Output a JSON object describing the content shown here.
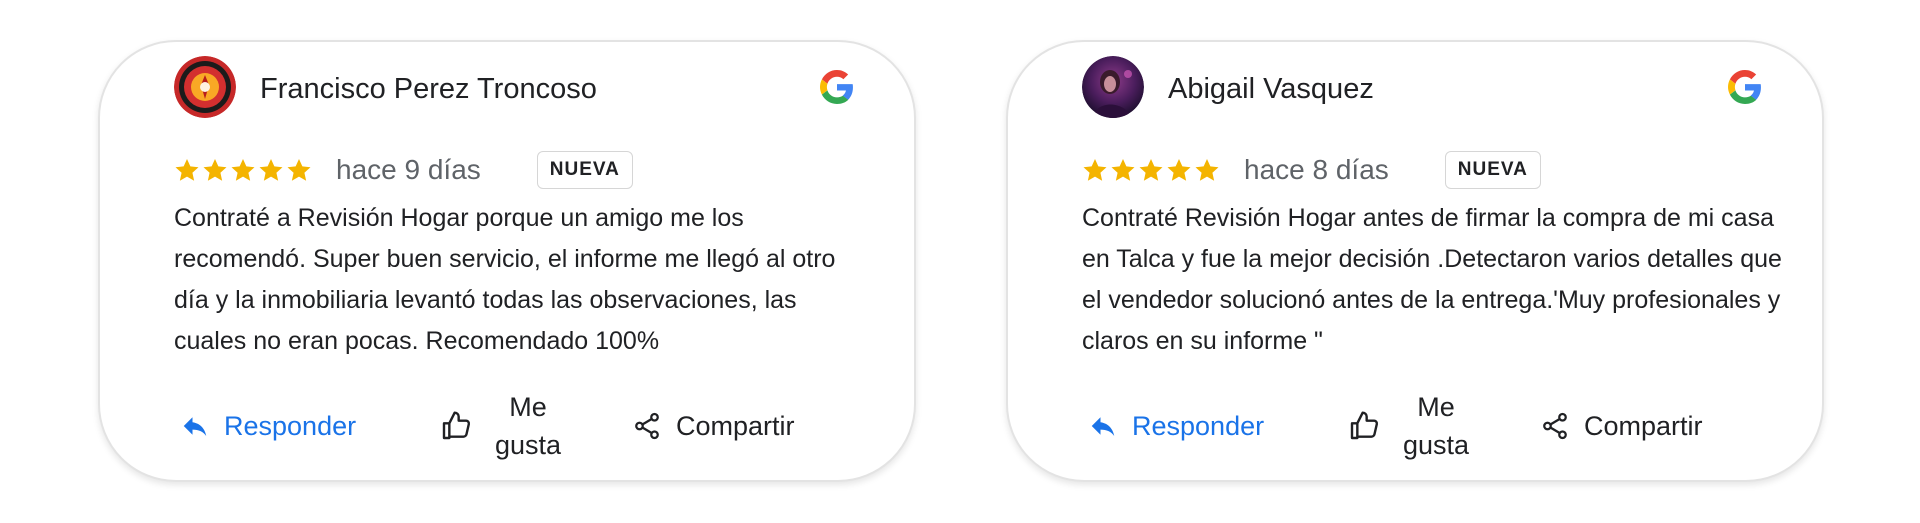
{
  "reviews": [
    {
      "author": "Francisco Perez Troncoso",
      "date": "hace 9 días",
      "badge": "NUEVA",
      "rating": 5,
      "text": "Contraté a Revisión Hogar porque un amigo me los recomendó. Super buen servicio, el informe me llegó al otro día y la inmobiliaria levantó todas las observaciones, las cuales no eran pocas. Recomendado 100%",
      "avatar_icon": "fire-department-logo-icon",
      "actions": {
        "reply": "Responder",
        "like_line1": "Me",
        "like_line2": "gusta",
        "share": "Compartir"
      }
    },
    {
      "author": "Abigail Vasquez",
      "date": "hace 8 días",
      "badge": "NUEVA",
      "rating": 5,
      "text": "Contraté Revisión Hogar antes de firmar la compra de mi casa en Talca y fue la mejor decisión .Detectaron varios detalles que el vendedor solucionó antes de la entrega.'Muy profesionales y claros en su informe \"",
      "avatar_icon": "user-photo-avatar",
      "actions": {
        "reply": "Responder",
        "like_line1": "Me",
        "like_line2": "gusta",
        "share": "Compartir"
      }
    }
  ],
  "colors": {
    "star": "#f4b400",
    "reply": "#1a73e8",
    "text": "#202124",
    "muted": "#5f6368",
    "card_border": "#e3e3e3"
  },
  "icons": [
    "google-g-icon",
    "star-icon",
    "reply-arrow-icon",
    "thumb-up-icon",
    "share-icon"
  ]
}
